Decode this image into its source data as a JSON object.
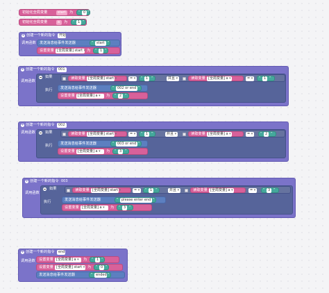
{
  "ui": {
    "init_label": "初始化全局变量",
    "to": "为",
    "open_quote": "“",
    "close_quote": "”",
    "create_label": "创建一个新的指令",
    "call_func": "调用函数",
    "if": "如果",
    "exec": "执行",
    "and": "并且",
    "set_var": "设置变量",
    "get_var": "读取变量",
    "send_msg": "发送消息给事件发送器",
    "global_prefix": "[全局变量]",
    "eq": "=",
    "plus": "+",
    "minus": "-"
  },
  "globals": [
    {
      "name": "start",
      "value": "0"
    },
    {
      "name": "a",
      "value": "1"
    }
  ],
  "commands": [
    {
      "name": "开始",
      "send": "start",
      "set_var": "start",
      "set_val": "1"
    },
    {
      "name": "001",
      "cmp1_var": "start",
      "cmp1_val": "1",
      "cmp2_var": "a",
      "cmp2_val": "1",
      "send": "002 or end",
      "set_var": "a",
      "set_val": "2"
    },
    {
      "name": "002",
      "cmp1_var": "start",
      "cmp1_val": "1",
      "cmp2_var": "a",
      "cmp2_val": "2",
      "send": "003 or end",
      "set_var": "a",
      "set_val": "3"
    },
    {
      "name": "003",
      "cmp1_var": "start",
      "cmp1_val": "1",
      "cmp2_var": "a",
      "cmp2_val": "3",
      "send": "please enter end",
      "set_var": "a",
      "set_val": "3"
    },
    {
      "name": "end",
      "set1_var": "a",
      "set1_val": "1",
      "set2_var": "start",
      "set2_val": "0",
      "send": "ended"
    }
  ]
}
